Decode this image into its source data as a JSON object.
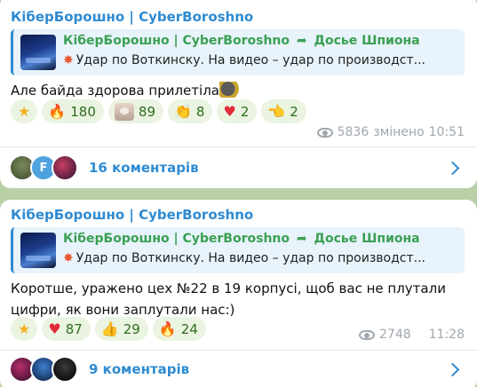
{
  "posts": [
    {
      "sender": "КіберБорошно | CyberBoroshno",
      "forward": {
        "title": "КіберБорошно | CyberBoroshno",
        "arrow_icon": "forward-arrow-icon",
        "source": "Досье Шпиона",
        "preview": "Удар по Воткинску.  На видео – удар по производст..."
      },
      "text": "Але байда здорова прилетіла",
      "reactions": [
        {
          "icon": "star-icon",
          "glyph": "★",
          "count": ""
        },
        {
          "icon": "fire-icon",
          "glyph": "🔥",
          "count": "180"
        },
        {
          "icon": "sticker-icon",
          "glyph": "",
          "count": "89"
        },
        {
          "icon": "clap-icon",
          "glyph": "👏",
          "count": "8"
        },
        {
          "icon": "heart-icon",
          "glyph": "♥",
          "count": "2"
        },
        {
          "icon": "point-icon",
          "glyph": "👈",
          "count": "2"
        }
      ],
      "views": "5836",
      "edited": "змінено",
      "time": "10:51",
      "comments": "16 коментарів"
    },
    {
      "sender": "КіберБорошно | CyberBoroshno",
      "forward": {
        "title": "КіберБорошно | CyberBoroshno",
        "arrow_icon": "forward-arrow-icon",
        "source": "Досье Шпиона",
        "preview": "Удар по Воткинску.  На видео – удар по производст..."
      },
      "text_line1": "Коротше, уражено цех №22 в 19 корпусі, щоб вас не плутали",
      "text_line2": "цифри, як вони заплутали нас:)",
      "reactions": [
        {
          "icon": "star-icon",
          "glyph": "★",
          "count": ""
        },
        {
          "icon": "heart-icon",
          "glyph": "♥",
          "count": "87"
        },
        {
          "icon": "thumbs-up-icon",
          "glyph": "👍",
          "count": "29"
        },
        {
          "icon": "fire-icon",
          "glyph": "🔥",
          "count": "24"
        }
      ],
      "views": "2748",
      "time": "11:28",
      "comments": "9 коментарів"
    }
  ],
  "colors": {
    "background": "#b9cfa6",
    "accent": "#2f8bd1",
    "forward_title": "#3aa053",
    "reaction_bg": "#eaf4e1"
  }
}
